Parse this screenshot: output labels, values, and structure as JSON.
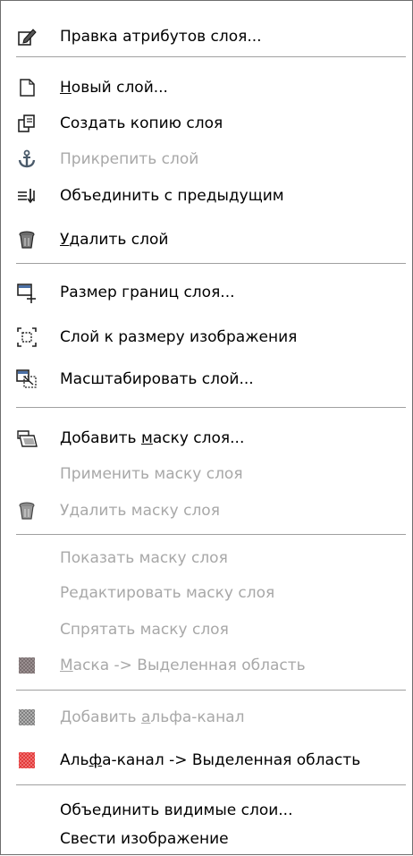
{
  "menu": {
    "items": [
      {
        "label": "Правка атрибутов слоя...",
        "icon": "edit-layer-attributes-icon",
        "enabled": true
      },
      {
        "label_pre": "",
        "label_ul": "Н",
        "label_post": "овый слой...",
        "icon": "new-layer-icon",
        "enabled": true
      },
      {
        "label": "Создать копию слоя",
        "icon": "duplicate-layer-icon",
        "enabled": true
      },
      {
        "label": "Прикрепить слой",
        "icon": "anchor-icon",
        "enabled": false
      },
      {
        "label": "Объединить с предыдущим",
        "icon": "merge-down-icon",
        "enabled": true
      },
      {
        "label_pre": "",
        "label_ul": "У",
        "label_post": "далить слой",
        "icon": "trash-icon",
        "enabled": true
      },
      {
        "label": "Размер границ слоя...",
        "icon": "layer-boundary-size-icon",
        "enabled": true
      },
      {
        "label": "Слой к размеру изображения",
        "icon": "layer-to-image-size-icon",
        "enabled": true
      },
      {
        "label": "Масштабировать слой...",
        "icon": "scale-layer-icon",
        "enabled": true
      },
      {
        "label_pre": "Добавить ",
        "label_ul": "м",
        "label_post": "аску слоя...",
        "icon": "add-mask-icon",
        "enabled": true
      },
      {
        "label": "Применить маску слоя",
        "icon": "",
        "enabled": false
      },
      {
        "label": "Удалить маску слоя",
        "icon": "trash-icon",
        "enabled": false
      },
      {
        "label": "Показать маску слоя",
        "icon": "",
        "enabled": false
      },
      {
        "label": "Редактировать маску слоя",
        "icon": "",
        "enabled": false
      },
      {
        "label": "Спрятать маску слоя",
        "icon": "",
        "enabled": false
      },
      {
        "label_pre": "",
        "label_ul": "М",
        "label_post": "аска -> Выделенная область",
        "icon": "mask-to-selection-icon",
        "enabled": false
      },
      {
        "label_pre": "Добавить ",
        "label_ul": "а",
        "label_post": "льфа-канал",
        "icon": "add-alpha-icon",
        "enabled": false
      },
      {
        "label_pre": "Аль",
        "label_ul": "ф",
        "label_post": "а-канал -> Выделенная область",
        "icon": "alpha-to-selection-icon",
        "enabled": true
      },
      {
        "label": "Объединить видимые слои...",
        "icon": "",
        "enabled": true
      },
      {
        "label": "Свести изображение",
        "icon": "",
        "enabled": true
      }
    ]
  },
  "colors": {
    "disabled_text": "#a8a8a8",
    "separator": "#a0a0a0",
    "alpha_red": "#e23a3a"
  }
}
